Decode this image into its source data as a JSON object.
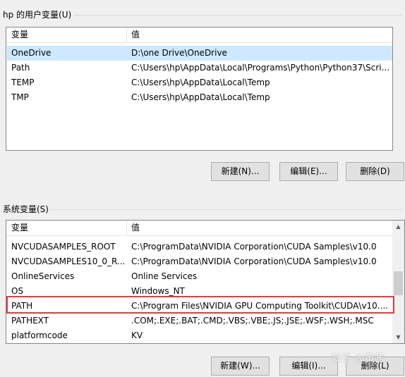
{
  "user_vars": {
    "title": "hp 的用户变量(U)",
    "col_var": "变量",
    "col_val": "值",
    "rows": [
      {
        "name": "OneDrive",
        "value": "D:\\one Drive\\OneDrive"
      },
      {
        "name": "Path",
        "value": "C:\\Users\\hp\\AppData\\Local\\Programs\\Python\\Python37\\Scri..."
      },
      {
        "name": "TEMP",
        "value": "C:\\Users\\hp\\AppData\\Local\\Temp"
      },
      {
        "name": "TMP",
        "value": "C:\\Users\\hp\\AppData\\Local\\Temp"
      }
    ],
    "new_label": "新建(N)...",
    "edit_label": "编辑(E)...",
    "delete_label": "删除(D)"
  },
  "system_vars": {
    "title": "系统变量(S)",
    "col_var": "变量",
    "col_val": "值",
    "rows": [
      {
        "name": "NVCUDASAMPLES_ROOT",
        "value": "C:\\ProgramData\\NVIDIA Corporation\\CUDA Samples\\v10.0"
      },
      {
        "name": "NVCUDASAMPLES10_0_R...",
        "value": "C:\\ProgramData\\NVIDIA Corporation\\CUDA Samples\\v10.0"
      },
      {
        "name": "OnlineServices",
        "value": "Online Services"
      },
      {
        "name": "OS",
        "value": "Windows_NT"
      },
      {
        "name": "PATH",
        "value": "C:\\Program Files\\NVIDIA GPU Computing Toolkit\\CUDA\\v10...."
      },
      {
        "name": "PATHEXT",
        "value": ".COM;.EXE;.BAT;.CMD;.VBS;.VBE;.JS;.JSE;.WSF;.WSH;.MSC"
      },
      {
        "name": "platformcode",
        "value": "KV"
      }
    ],
    "new_label": "新建(W)...",
    "edit_label": "编辑(I)...",
    "delete_label": "删除(L)"
  },
  "watermark": "知乎 @黄茜",
  "colors": {
    "highlight": "#e03c3c",
    "selected_row": "#cde8ff"
  }
}
